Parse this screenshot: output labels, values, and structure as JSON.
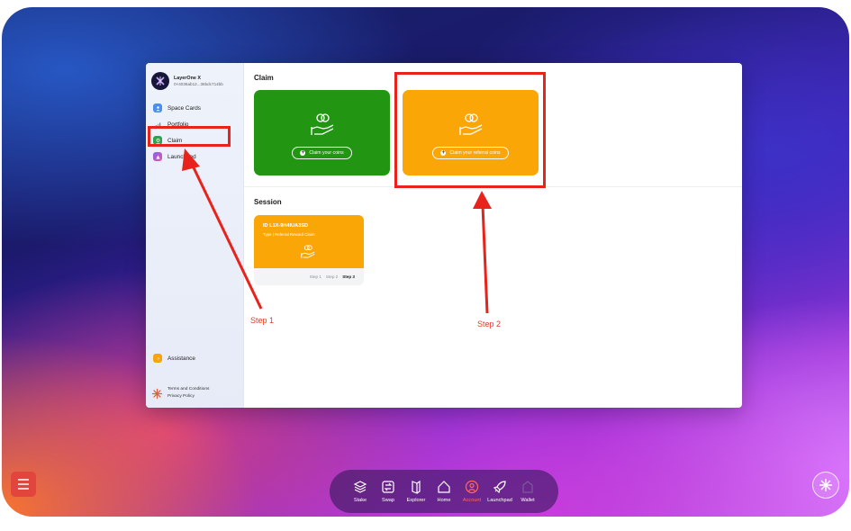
{
  "profile": {
    "name": "LayerOne X",
    "address": "0×4036ab12...36bdc714bb"
  },
  "sidebar": {
    "items": [
      {
        "label": "Space Cards",
        "icon": "space-cards-icon"
      },
      {
        "label": "Portfolio",
        "icon": "portfolio-chart-icon"
      },
      {
        "label": "Claim",
        "icon": "claim-icon",
        "active": true
      },
      {
        "label": "Launchpad",
        "icon": "launchpad-icon"
      }
    ],
    "assistance_label": "Assistance",
    "terms_label": "Terms and Conditions",
    "privacy_label": "Privacy Policy"
  },
  "claim": {
    "title": "Claim",
    "coins_button": "Claim your coins",
    "referral_button": "Claim your referral coins"
  },
  "session": {
    "title": "Session",
    "id": "ID L1X-9H4IUA3SD",
    "type": "Type | Referral Reward Claim",
    "steps": [
      "Step 1",
      "Step 2",
      "Step 3"
    ],
    "active_step": 3
  },
  "annotations": {
    "step1": "Step 1",
    "step2": "Step 2",
    "color": "#e8231b"
  },
  "dock": {
    "items": [
      {
        "label": "Stake",
        "icon": "stake-layers-icon"
      },
      {
        "label": "Swap",
        "icon": "swap-icon"
      },
      {
        "label": "Explorer",
        "icon": "explorer-icon"
      },
      {
        "label": "Home",
        "icon": "home-icon"
      },
      {
        "label": "Account",
        "icon": "account-icon",
        "active": true
      },
      {
        "label": "Launchpad",
        "icon": "rocket-icon"
      },
      {
        "label": "Wallet",
        "icon": "wallet-icon"
      }
    ]
  },
  "colors": {
    "green_card": "#229612",
    "orange_card": "#f9a606",
    "accent_red": "#e8231b"
  }
}
